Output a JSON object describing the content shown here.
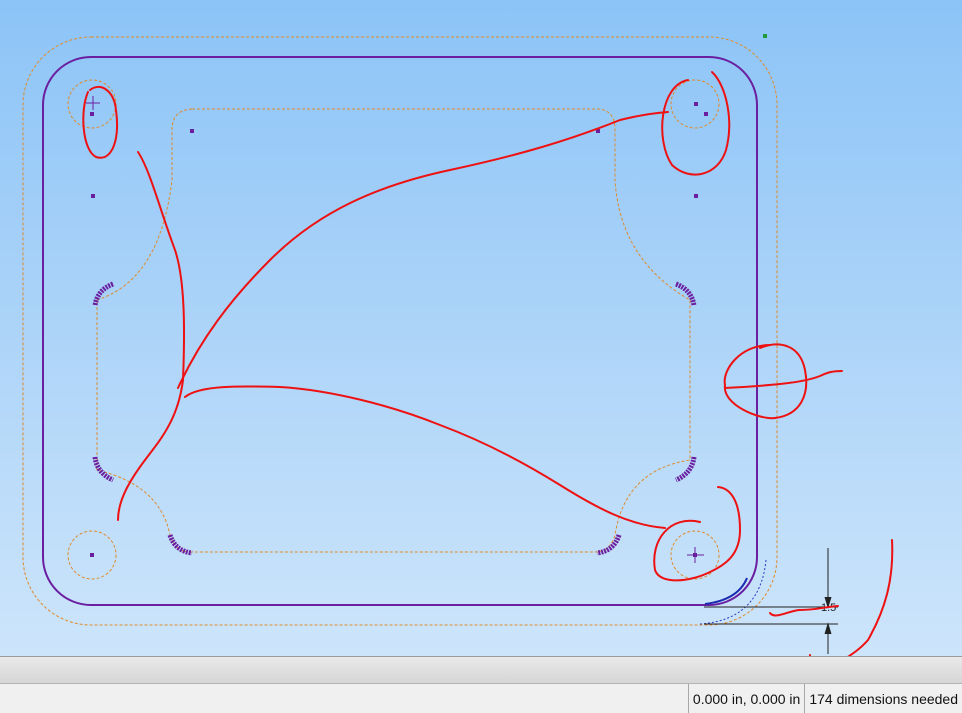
{
  "sketch": {
    "dimension_label": "1.5",
    "colors": {
      "profile": "#6a1fa0",
      "construction": "#e08a2a",
      "markup": "#ee1111",
      "background_top": "#8cc4f7",
      "background_bottom": "#cde5fb"
    }
  },
  "status_bar": {
    "coordinates": "0.000 in, 0.000 in",
    "dimensions_needed": "174 dimensions needed"
  }
}
